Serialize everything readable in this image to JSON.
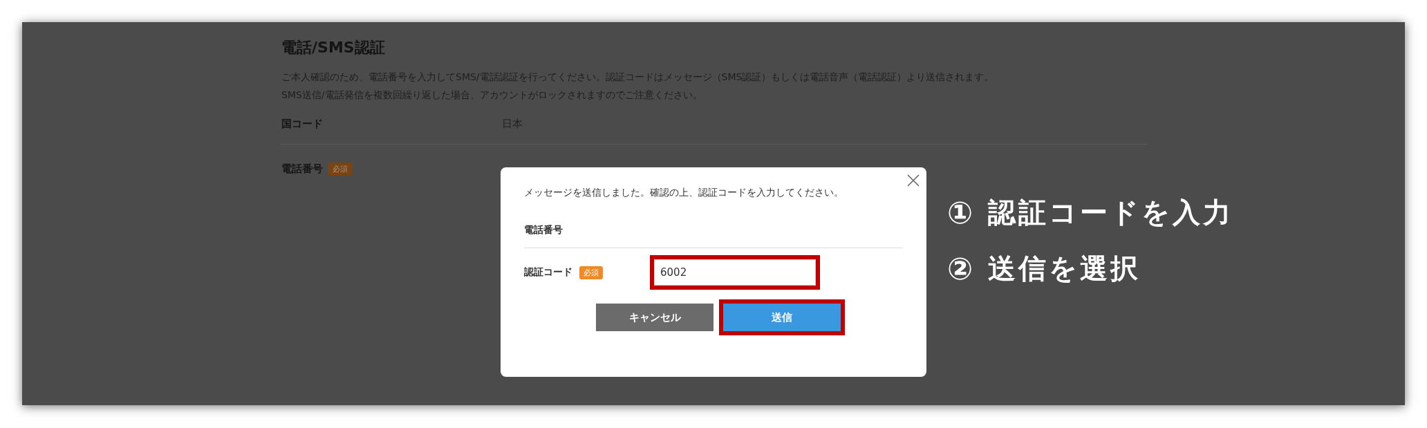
{
  "page": {
    "title": "電話/SMS認証",
    "description": [
      "ご本人確認のため、電話番号を入力してSMS/電話認証を行ってください。認証コードはメッセージ（SMS認証）もしくは電話音声（電話認証）より送信されます。",
      "SMS送信/電話発信を複数回繰り返した場合、アカウントがロックされますのでご注意ください。"
    ],
    "fields": [
      {
        "label": "国コード",
        "value": "日本"
      },
      {
        "label": "電話番号",
        "badge": "必須"
      }
    ]
  },
  "dialog": {
    "message": "メッセージを送信しました。確認の上、認証コードを入力してください。",
    "phone_label": "電話番号",
    "code_field": {
      "label": "認証コード",
      "badge": "必須",
      "value": "6002",
      "highlighted": true
    },
    "buttons": [
      {
        "label": "キャンセル",
        "kind": "cancel",
        "highlighted": false
      },
      {
        "label": "送信",
        "kind": "submit",
        "highlighted": true
      }
    ]
  },
  "annotations": [
    {
      "number": "①",
      "text": "認証コードを入力"
    },
    {
      "number": "②",
      "text": "送信を選択"
    }
  ]
}
